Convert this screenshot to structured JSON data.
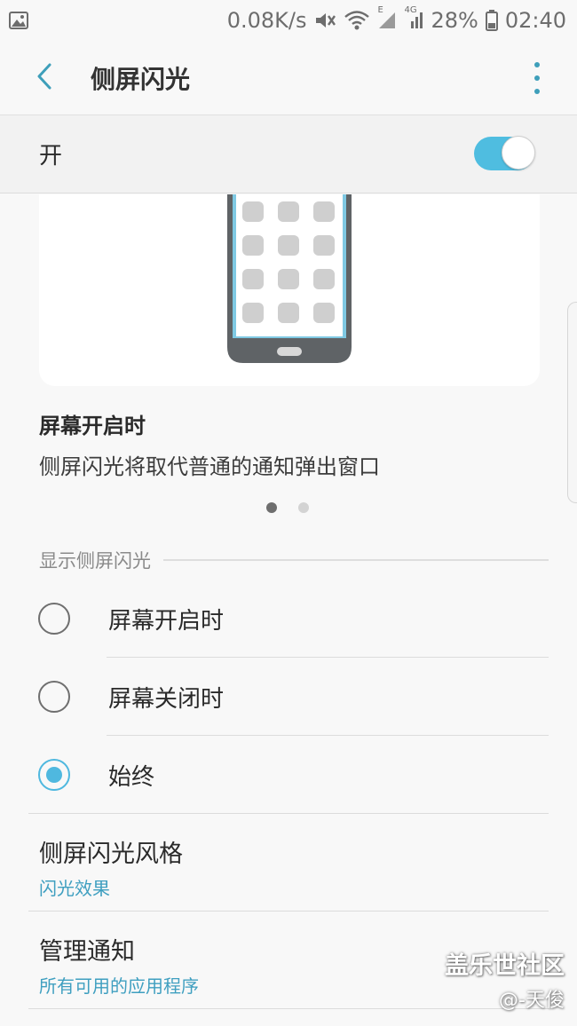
{
  "status_bar": {
    "network_speed": "0.08K/s",
    "network_type": "4G",
    "data_indicator": "E",
    "battery": "28%",
    "time": "02:40",
    "icons": [
      "image-icon",
      "mute-icon",
      "wifi-icon",
      "signal-icon",
      "signal-4g-icon",
      "battery-icon"
    ]
  },
  "app_bar": {
    "title": "侧屏闪光"
  },
  "master_switch": {
    "label": "开",
    "state": true
  },
  "preview": {
    "heading": "屏幕开启时",
    "description": "侧屏闪光将取代普通的通知弹出窗口",
    "page_count": 2,
    "current_page": 1
  },
  "display_section": {
    "title": "显示侧屏闪光",
    "options": [
      {
        "label": "屏幕开启时",
        "checked": false
      },
      {
        "label": "屏幕关闭时",
        "checked": false
      },
      {
        "label": "始终",
        "checked": true
      }
    ]
  },
  "settings": [
    {
      "title": "侧屏闪光风格",
      "subtitle": "闪光效果"
    },
    {
      "title": "管理通知",
      "subtitle": "所有可用的应用程序"
    }
  ],
  "watermark": {
    "main": "盖乐世社区",
    "sub": "@-天俊"
  },
  "colors": {
    "accent": "#4fbde0",
    "link": "#3f9fc0",
    "icon": "#3e9fba",
    "pager_active": "#6e6e6e",
    "pager_inactive": "#d3d3d3"
  }
}
